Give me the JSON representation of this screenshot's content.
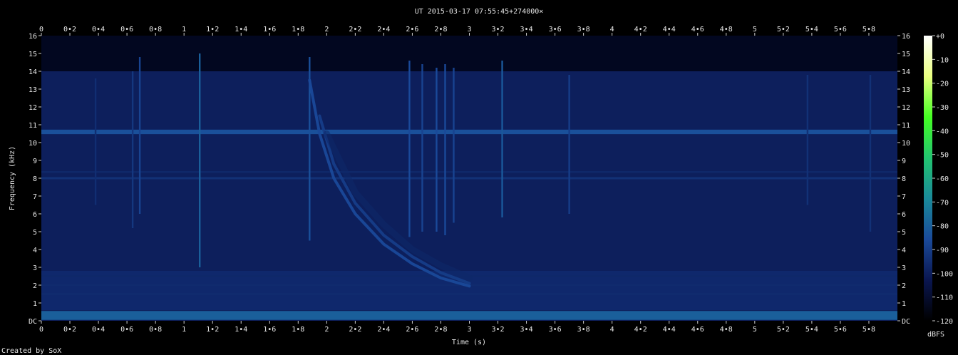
{
  "chart_data": {
    "type": "heatmap",
    "title": "UT 2015-03-17 07:55:45+274000×",
    "xlabel": "Time (s)",
    "ylabel": "Frequency (kHz)",
    "xlim": [
      0,
      6
    ],
    "ylim": [
      0,
      16
    ],
    "x_ticks": [
      "0",
      "0•2",
      "0•4",
      "0•6",
      "0•8",
      "1",
      "1•2",
      "1•4",
      "1•6",
      "1•8",
      "2",
      "2•2",
      "2•4",
      "2•6",
      "2•8",
      "3",
      "3•2",
      "3•4",
      "3•6",
      "3•8",
      "4",
      "4•2",
      "4•4",
      "4•6",
      "4•8",
      "5",
      "5•2",
      "5•4",
      "5•6",
      "5•8"
    ],
    "x_tick_values": [
      0,
      0.2,
      0.4,
      0.6,
      0.8,
      1,
      1.2,
      1.4,
      1.6,
      1.8,
      2,
      2.2,
      2.4,
      2.6,
      2.8,
      3,
      3.2,
      3.4,
      3.6,
      3.8,
      4,
      4.2,
      4.4,
      4.6,
      4.8,
      5,
      5.2,
      5.4,
      5.6,
      5.8
    ],
    "y_ticks": [
      "DC",
      "1",
      "2",
      "3",
      "4",
      "5",
      "6",
      "7",
      "8",
      "9",
      "10",
      "11",
      "12",
      "13",
      "14",
      "15",
      "16"
    ],
    "colorbar": {
      "label": "dBFS",
      "ticks": [
        "+0",
        "-10",
        "-20",
        "-30",
        "-40",
        "-50",
        "-60",
        "-70",
        "-80",
        "-90",
        "-100",
        "-110",
        "-120"
      ],
      "range": [
        -120,
        0
      ],
      "colors": [
        "#000000",
        "#0a1650",
        "#1a4a9a",
        "#1a8a9a",
        "#22c470",
        "#44ff22",
        "#eaff80",
        "#ffffff"
      ]
    },
    "background_level_db": -100,
    "horizontal_bands": [
      {
        "freq_khz": 0.3,
        "width_khz": 0.5,
        "level_db": -80
      },
      {
        "freq_khz": 1.5,
        "width_khz": 0.12,
        "level_db": -96
      },
      {
        "freq_khz": 2.0,
        "width_khz": 0.1,
        "level_db": -96
      },
      {
        "freq_khz": 2.5,
        "width_khz": 0.1,
        "level_db": -97
      },
      {
        "freq_khz": 8.0,
        "width_khz": 0.12,
        "level_db": -94
      },
      {
        "freq_khz": 8.35,
        "width_khz": 0.1,
        "level_db": -97
      },
      {
        "freq_khz": 10.6,
        "width_khz": 0.25,
        "level_db": -84
      }
    ],
    "impulses": [
      {
        "t": 0.38,
        "f_min": 6.5,
        "f_max": 13.6,
        "level_db": -95
      },
      {
        "t": 0.64,
        "f_min": 5.2,
        "f_max": 14.0,
        "level_db": -92
      },
      {
        "t": 0.69,
        "f_min": 6.0,
        "f_max": 14.8,
        "level_db": -88
      },
      {
        "t": 1.11,
        "f_min": 3.0,
        "f_max": 15.0,
        "level_db": -80
      },
      {
        "t": 1.88,
        "f_min": 4.5,
        "f_max": 14.8,
        "level_db": -84
      },
      {
        "t": 2.58,
        "f_min": 4.7,
        "f_max": 14.6,
        "level_db": -86
      },
      {
        "t": 2.67,
        "f_min": 5.0,
        "f_max": 14.4,
        "level_db": -88
      },
      {
        "t": 2.77,
        "f_min": 5.0,
        "f_max": 14.2,
        "level_db": -86
      },
      {
        "t": 2.83,
        "f_min": 4.8,
        "f_max": 14.4,
        "level_db": -86
      },
      {
        "t": 2.89,
        "f_min": 5.5,
        "f_max": 14.2,
        "level_db": -88
      },
      {
        "t": 3.23,
        "f_min": 5.8,
        "f_max": 14.6,
        "level_db": -82
      },
      {
        "t": 3.7,
        "f_min": 6.0,
        "f_max": 13.8,
        "level_db": -90
      },
      {
        "t": 5.37,
        "f_min": 6.5,
        "f_max": 13.8,
        "level_db": -94
      },
      {
        "t": 5.81,
        "f_min": 5.0,
        "f_max": 13.8,
        "level_db": -94
      }
    ],
    "whistler_traces": [
      {
        "points": [
          [
            1.88,
            13.5
          ],
          [
            1.95,
            10.5
          ],
          [
            2.05,
            8.0
          ],
          [
            2.2,
            6.0
          ],
          [
            2.4,
            4.3
          ],
          [
            2.6,
            3.2
          ],
          [
            2.8,
            2.4
          ],
          [
            3.0,
            1.95
          ]
        ],
        "level_db": -86
      },
      {
        "points": [
          [
            1.95,
            11.5
          ],
          [
            2.05,
            8.8
          ],
          [
            2.2,
            6.6
          ],
          [
            2.4,
            4.8
          ],
          [
            2.6,
            3.6
          ],
          [
            2.8,
            2.7
          ],
          [
            3.0,
            2.1
          ]
        ],
        "level_db": -90
      },
      {
        "points": [
          [
            2.0,
            10.5
          ],
          [
            2.2,
            7.2
          ],
          [
            2.4,
            5.4
          ],
          [
            2.6,
            4.0
          ],
          [
            2.8,
            3.1
          ],
          [
            3.0,
            2.4
          ]
        ],
        "level_db": -97
      }
    ],
    "footer": "Created by SoX"
  }
}
